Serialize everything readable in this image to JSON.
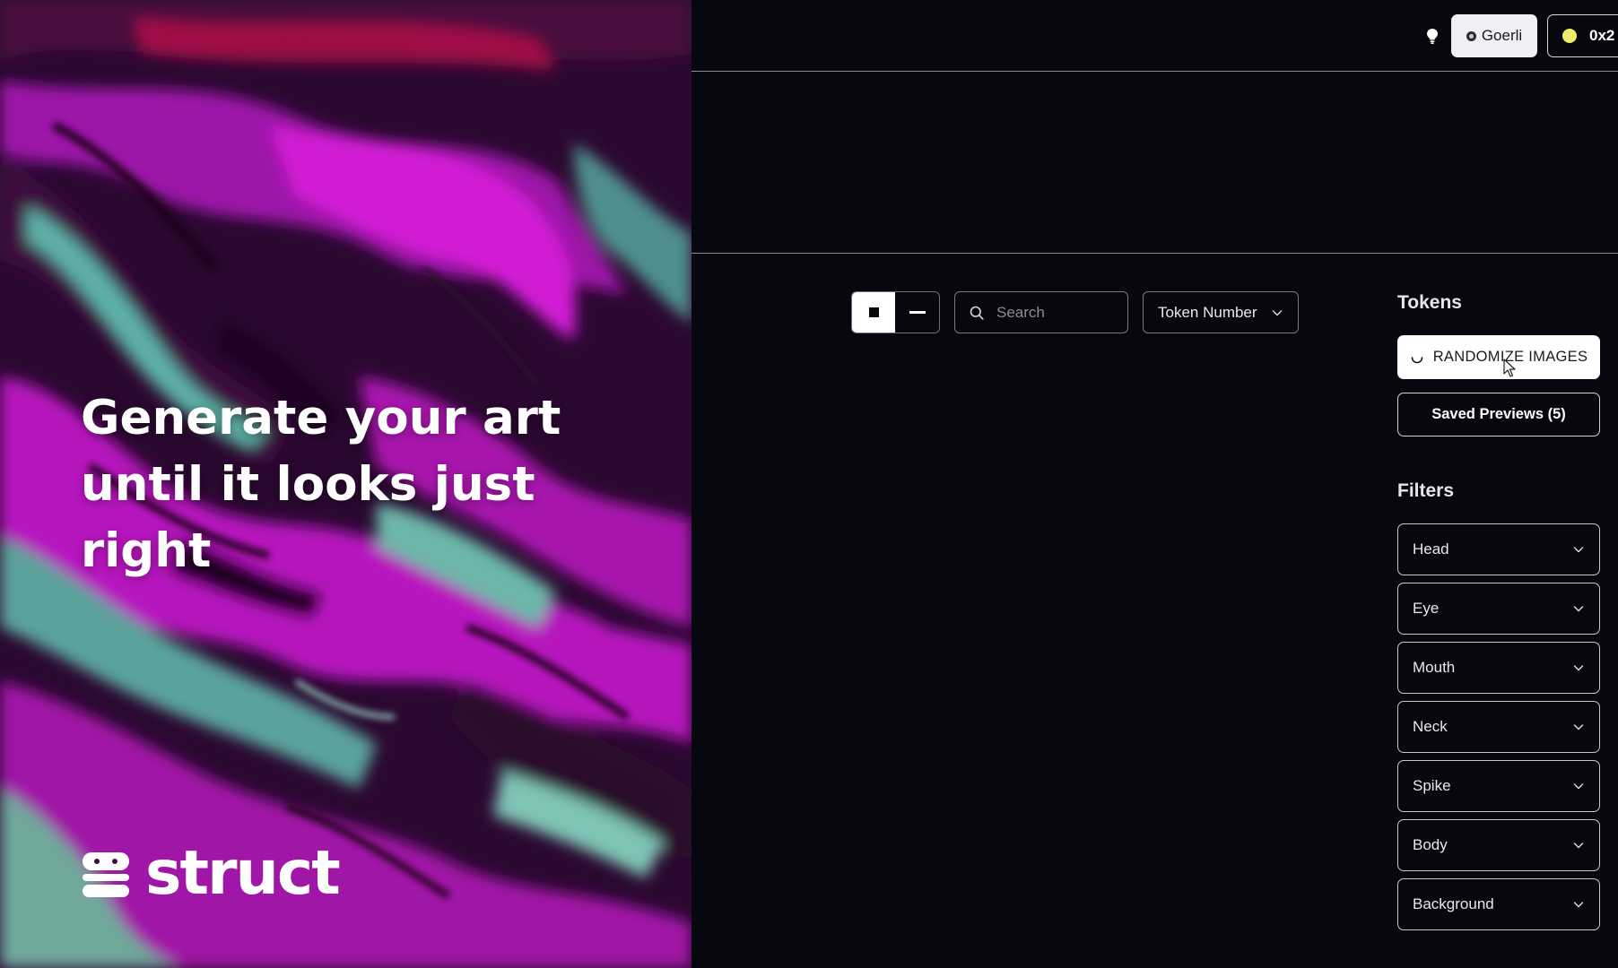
{
  "hero": {
    "headline": "Generate your art until it looks just right",
    "brand_name": "struct"
  },
  "topbar": {
    "network_label": "Goerli",
    "account_label": "0x2",
    "account_dot_color": "#f0ea6a",
    "theme_icon": "lightbulb-icon"
  },
  "toolbar": {
    "view_modes": [
      "grid",
      "list"
    ],
    "active_view": "grid",
    "search_placeholder": "Search",
    "sort_label": "Token Number"
  },
  "sidebar": {
    "tokens_heading": "Tokens",
    "randomize_label": "RANDOMIZE IMAGES",
    "saved_previews_label": "Saved Previews (5)",
    "filters_heading": "Filters",
    "filters": [
      {
        "label": "Head"
      },
      {
        "label": "Eye"
      },
      {
        "label": "Mouth"
      },
      {
        "label": "Neck"
      },
      {
        "label": "Spike"
      },
      {
        "label": "Body"
      },
      {
        "label": "Background"
      }
    ]
  },
  "colors": {
    "background": "#07080f",
    "art_magenta": "#b012b8",
    "art_teal": "#5fa6a0"
  }
}
